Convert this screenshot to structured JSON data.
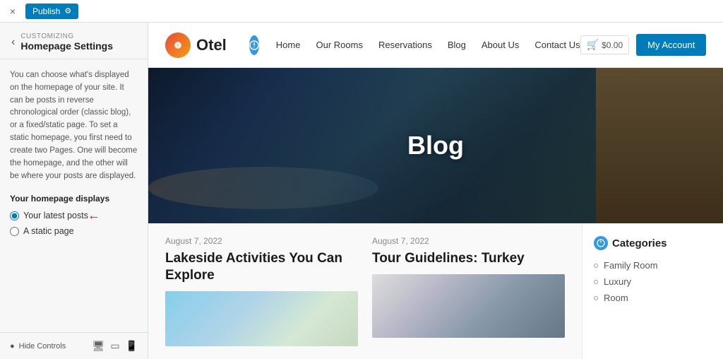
{
  "admin_bar": {
    "close_label": "×",
    "publish_label": "Publish",
    "gear_symbol": "⚙"
  },
  "sidebar": {
    "customizing_label": "Customizing",
    "title": "Homepage Settings",
    "description": "You can choose what's displayed on the homepage of your site. It can be posts in reverse chronological order (classic blog), or a fixed/static page. To set a static homepage, you first need to create two Pages. One will become the homepage, and the other will be where your posts are displayed.",
    "section_label": "Your homepage displays",
    "radio_options": [
      {
        "id": "latest_posts",
        "label": "Your latest posts",
        "selected": true
      },
      {
        "id": "static_page",
        "label": "A static page",
        "selected": false
      }
    ],
    "footer": {
      "hide_controls_label": "Hide Controls",
      "eye_symbol": "👁",
      "desktop_icon": "🖥",
      "tablet_icon": "⬜",
      "mobile_icon": "📱"
    }
  },
  "nav": {
    "logo_text": "Otel",
    "links": [
      {
        "label": "Home"
      },
      {
        "label": "Our Rooms"
      },
      {
        "label": "Reservations"
      },
      {
        "label": "Blog"
      },
      {
        "label": "About Us"
      },
      {
        "label": "Contact Us"
      }
    ],
    "cart_price": "$0.00",
    "account_button": "My Account"
  },
  "hero": {
    "title": "Blog"
  },
  "posts": [
    {
      "date": "August 7, 2022",
      "title": "Lakeside Activities You Can Explore"
    },
    {
      "date": "August 7, 2022",
      "title": "Tour Guidelines: Turkey"
    }
  ],
  "categories": {
    "title": "Categories",
    "items": [
      {
        "label": "Family Room"
      },
      {
        "label": "Luxury"
      },
      {
        "label": "Room"
      }
    ]
  }
}
